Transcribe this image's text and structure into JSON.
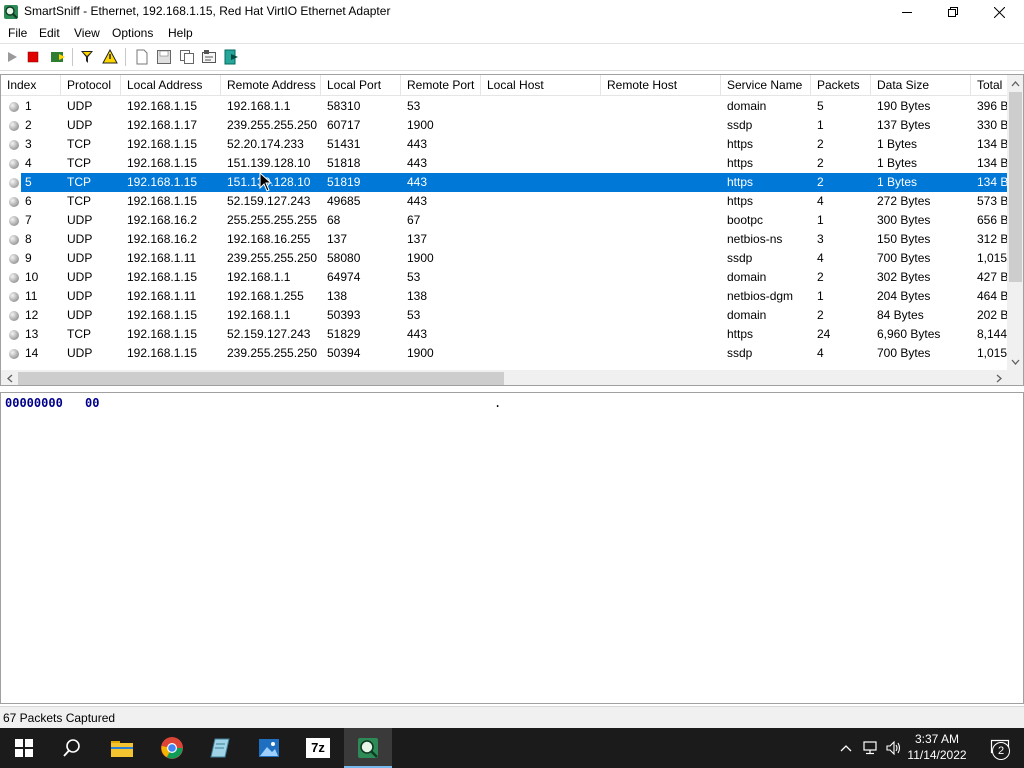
{
  "window": {
    "title": "SmartSniff  -  Ethernet, 192.168.1.15, Red Hat VirtIO Ethernet Adapter",
    "app_icon": "smartsniff-icon"
  },
  "menu": [
    "File",
    "Edit",
    "View",
    "Options",
    "Help"
  ],
  "toolbar": {
    "icons": [
      "start-capture-icon",
      "stop-capture-icon",
      "capture-options-icon",
      "filter-icon",
      "display-filter-icon",
      "new-icon",
      "save-icon",
      "copy-icon",
      "html-report-icon",
      "properties-icon",
      "exit-icon"
    ]
  },
  "columns": [
    "Index",
    "Protocol",
    "Local Address",
    "Remote Address",
    "Local Port",
    "Remote Port",
    "Local Host",
    "Remote Host",
    "Service Name",
    "Packets",
    "Data Size",
    "Total"
  ],
  "rows": [
    {
      "index": "1",
      "protocol": "UDP",
      "local_address": "192.168.1.15",
      "remote_address": "192.168.1.1",
      "local_port": "58310",
      "remote_port": "53",
      "local_host": "",
      "remote_host": "",
      "service": "domain",
      "packets": "5",
      "data_size": "190 Bytes",
      "total": "396 B"
    },
    {
      "index": "2",
      "protocol": "UDP",
      "local_address": "192.168.1.17",
      "remote_address": "239.255.255.250",
      "local_port": "60717",
      "remote_port": "1900",
      "local_host": "",
      "remote_host": "",
      "service": "ssdp",
      "packets": "1",
      "data_size": "137 Bytes",
      "total": "330 B"
    },
    {
      "index": "3",
      "protocol": "TCP",
      "local_address": "192.168.1.15",
      "remote_address": "52.20.174.233",
      "local_port": "51431",
      "remote_port": "443",
      "local_host": "",
      "remote_host": "",
      "service": "https",
      "packets": "2",
      "data_size": "1 Bytes",
      "total": "134 B"
    },
    {
      "index": "4",
      "protocol": "TCP",
      "local_address": "192.168.1.15",
      "remote_address": "151.139.128.10",
      "local_port": "51818",
      "remote_port": "443",
      "local_host": "",
      "remote_host": "",
      "service": "https",
      "packets": "2",
      "data_size": "1 Bytes",
      "total": "134 B"
    },
    {
      "index": "5",
      "protocol": "TCP",
      "local_address": "192.168.1.15",
      "remote_address": "151.139.128.10",
      "local_port": "51819",
      "remote_port": "443",
      "local_host": "",
      "remote_host": "",
      "service": "https",
      "packets": "2",
      "data_size": "1 Bytes",
      "total": "134 B",
      "selected": true
    },
    {
      "index": "6",
      "protocol": "TCP",
      "local_address": "192.168.1.15",
      "remote_address": "52.159.127.243",
      "local_port": "49685",
      "remote_port": "443",
      "local_host": "",
      "remote_host": "",
      "service": "https",
      "packets": "4",
      "data_size": "272 Bytes",
      "total": "573 B"
    },
    {
      "index": "7",
      "protocol": "UDP",
      "local_address": "192.168.16.2",
      "remote_address": "255.255.255.255",
      "local_port": "68",
      "remote_port": "67",
      "local_host": "",
      "remote_host": "",
      "service": "bootpc",
      "packets": "1",
      "data_size": "300 Bytes",
      "total": "656 B"
    },
    {
      "index": "8",
      "protocol": "UDP",
      "local_address": "192.168.16.2",
      "remote_address": "192.168.16.255",
      "local_port": "137",
      "remote_port": "137",
      "local_host": "",
      "remote_host": "",
      "service": "netbios-ns",
      "packets": "3",
      "data_size": "150 Bytes",
      "total": "312 B"
    },
    {
      "index": "9",
      "protocol": "UDP",
      "local_address": "192.168.1.11",
      "remote_address": "239.255.255.250",
      "local_port": "58080",
      "remote_port": "1900",
      "local_host": "",
      "remote_host": "",
      "service": "ssdp",
      "packets": "4",
      "data_size": "700 Bytes",
      "total": "1,015"
    },
    {
      "index": "10",
      "protocol": "UDP",
      "local_address": "192.168.1.15",
      "remote_address": "192.168.1.1",
      "local_port": "64974",
      "remote_port": "53",
      "local_host": "",
      "remote_host": "",
      "service": "domain",
      "packets": "2",
      "data_size": "302 Bytes",
      "total": "427 B"
    },
    {
      "index": "11",
      "protocol": "UDP",
      "local_address": "192.168.1.11",
      "remote_address": "192.168.1.255",
      "local_port": "138",
      "remote_port": "138",
      "local_host": "",
      "remote_host": "",
      "service": "netbios-dgm",
      "packets": "1",
      "data_size": "204 Bytes",
      "total": "464 B"
    },
    {
      "index": "12",
      "protocol": "UDP",
      "local_address": "192.168.1.15",
      "remote_address": "192.168.1.1",
      "local_port": "50393",
      "remote_port": "53",
      "local_host": "",
      "remote_host": "",
      "service": "domain",
      "packets": "2",
      "data_size": "84 Bytes",
      "total": "202 B"
    },
    {
      "index": "13",
      "protocol": "TCP",
      "local_address": "192.168.1.15",
      "remote_address": "52.159.127.243",
      "local_port": "51829",
      "remote_port": "443",
      "local_host": "",
      "remote_host": "",
      "service": "https",
      "packets": "24",
      "data_size": "6,960 Bytes",
      "total": "8,144"
    },
    {
      "index": "14",
      "protocol": "UDP",
      "local_address": "192.168.1.15",
      "remote_address": "239.255.255.250",
      "local_port": "50394",
      "remote_port": "1900",
      "local_host": "",
      "remote_host": "",
      "service": "ssdp",
      "packets": "4",
      "data_size": "700 Bytes",
      "total": "1,015"
    }
  ],
  "hex": {
    "offset": "00000000",
    "bytes": "00",
    "ascii": "."
  },
  "status": {
    "text": "67 Packets Captured"
  },
  "taskbar": {
    "icons": [
      "windows-start-icon",
      "search-icon",
      "file-explorer-icon",
      "chrome-icon",
      "notepad-icon",
      "photos-icon",
      "7zip-icon",
      "smartsniff-taskbar-icon"
    ],
    "active": "smartsniff-taskbar-icon",
    "seven_zip_label": "7z",
    "time": "3:37 AM",
    "date": "11/14/2022",
    "notification_count": "2"
  },
  "colors": {
    "selection": "#0078d7",
    "taskbar": "#1b1b1b",
    "hex_text": "#00008b"
  }
}
